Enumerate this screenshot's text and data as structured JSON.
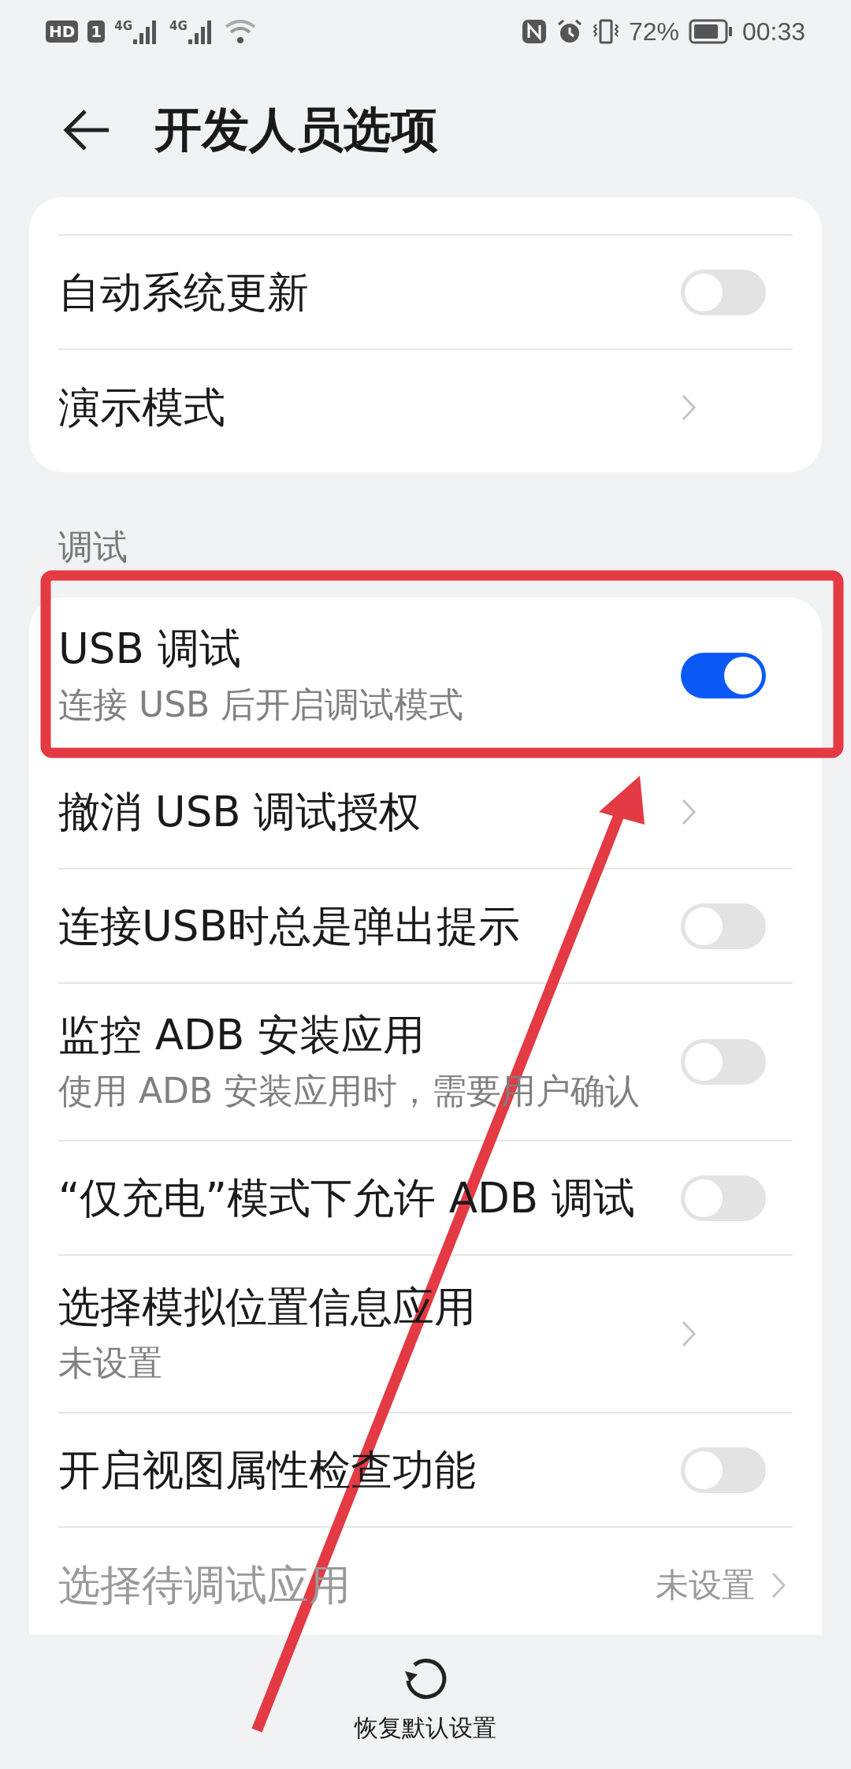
{
  "status_bar": {
    "badges": [
      "HD",
      "1"
    ],
    "networks": [
      "4G",
      "4G"
    ],
    "battery": "72%",
    "time": "00:33"
  },
  "header": {
    "title": "开发人员选项"
  },
  "sections": [
    {
      "rows": [
        {
          "kind": "switch",
          "title": "自动系统更新",
          "on": false,
          "disabled": false
        },
        {
          "kind": "link",
          "title": "演示模式",
          "disabled": false
        }
      ]
    },
    {
      "label": "调试",
      "rows": [
        {
          "kind": "switch",
          "title": "USB 调试",
          "subtitle": "连接 USB 后开启调试模式",
          "on": true,
          "disabled": false
        },
        {
          "kind": "link",
          "title": "撤消 USB 调试授权",
          "disabled": false
        },
        {
          "kind": "switch",
          "title": "连接USB时总是弹出提示",
          "on": false,
          "disabled": false
        },
        {
          "kind": "switch",
          "title": "监控 ADB 安装应用",
          "subtitle": "使用 ADB 安装应用时，需要用户确认",
          "on": false,
          "disabled": false
        },
        {
          "kind": "switch",
          "title": "“仅充电”模式下允许 ADB 调试",
          "on": false,
          "disabled": false
        },
        {
          "kind": "link",
          "title": "选择模拟位置信息应用",
          "subtitle": "未设置",
          "disabled": false
        },
        {
          "kind": "switch",
          "title": "开启视图属性检查功能",
          "on": false,
          "disabled": false
        },
        {
          "kind": "link",
          "title": "选择待调试应用",
          "value": "未设置",
          "disabled": true
        }
      ]
    }
  ],
  "bottom_action": {
    "label": "恢复默认设置"
  }
}
